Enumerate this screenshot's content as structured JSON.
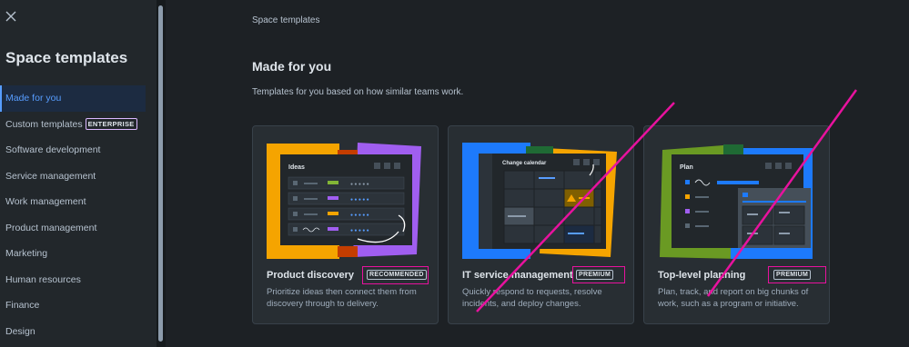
{
  "sidebar": {
    "title": "Space templates",
    "items": [
      {
        "label": "Made for you",
        "active": true
      },
      {
        "label": "Custom templates",
        "badge": "ENTERPRISE"
      },
      {
        "label": "Software development"
      },
      {
        "label": "Service management"
      },
      {
        "label": "Work management"
      },
      {
        "label": "Product management"
      },
      {
        "label": "Marketing"
      },
      {
        "label": "Human resources"
      },
      {
        "label": "Finance"
      },
      {
        "label": "Design"
      }
    ]
  },
  "main": {
    "breadcrumb": "Space templates",
    "heading": "Made for you",
    "description": "Templates for you based on how similar teams work.",
    "cards": [
      {
        "title": "Product discovery",
        "badge": "RECOMMENDED",
        "description": "Prioritize ideas then connect them from discovery through to delivery.",
        "preview_title": "Ideas"
      },
      {
        "title": "IT service management",
        "badge": "PREMIUM",
        "description": "Quickly respond to requests, resolve incidents, and deploy changes.",
        "preview_title": "Change calendar"
      },
      {
        "title": "Top-level planning",
        "badge": "PREMIUM",
        "description": "Plan, track, and report on big chunks of work, such as a program or initiative.",
        "preview_title": "Plan"
      }
    ]
  },
  "colors": {
    "accent": "#579dff",
    "annotation": "#e8129e",
    "background": "#1d2125"
  },
  "icons": {
    "close": "close-icon"
  }
}
